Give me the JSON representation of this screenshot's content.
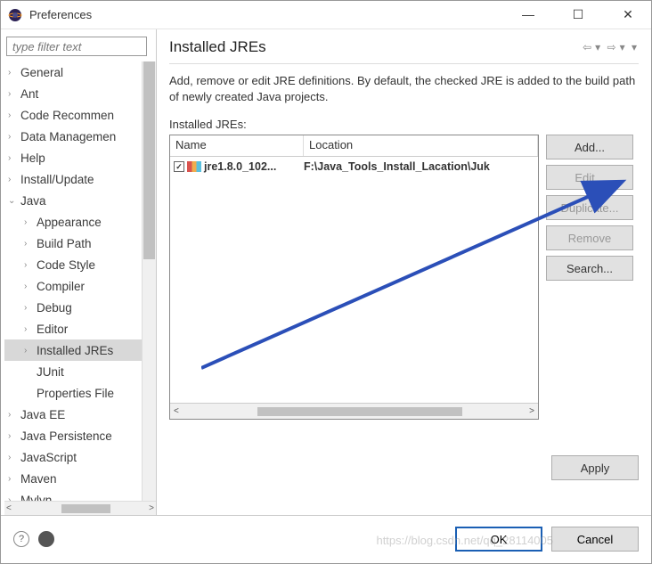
{
  "window": {
    "title": "Preferences"
  },
  "sidebar": {
    "filter_placeholder": "type filter text",
    "items": [
      {
        "label": "General",
        "twisty": "›"
      },
      {
        "label": "Ant",
        "twisty": "›"
      },
      {
        "label": "Code Recommen",
        "twisty": "›"
      },
      {
        "label": "Data Managemen",
        "twisty": "›"
      },
      {
        "label": "Help",
        "twisty": "›"
      },
      {
        "label": "Install/Update",
        "twisty": "›"
      },
      {
        "label": "Java",
        "twisty": "⌄",
        "expanded": true,
        "children": [
          {
            "label": "Appearance",
            "twisty": "›"
          },
          {
            "label": "Build Path",
            "twisty": "›"
          },
          {
            "label": "Code Style",
            "twisty": "›"
          },
          {
            "label": "Compiler",
            "twisty": "›"
          },
          {
            "label": "Debug",
            "twisty": "›"
          },
          {
            "label": "Editor",
            "twisty": "›"
          },
          {
            "label": "Installed JREs",
            "twisty": "›",
            "selected": true
          },
          {
            "label": "JUnit",
            "twisty": ""
          },
          {
            "label": "Properties File",
            "twisty": ""
          }
        ]
      },
      {
        "label": "Java EE",
        "twisty": "›"
      },
      {
        "label": "Java Persistence",
        "twisty": "›"
      },
      {
        "label": "JavaScript",
        "twisty": "›"
      },
      {
        "label": "Maven",
        "twisty": "›"
      },
      {
        "label": "Mylyn",
        "twisty": "›"
      }
    ]
  },
  "content": {
    "heading": "Installed JREs",
    "description": "Add, remove or edit JRE definitions. By default, the checked JRE is added to the build path of newly created Java projects.",
    "table_label": "Installed JREs:",
    "columns": {
      "name": "Name",
      "location": "Location"
    },
    "rows": [
      {
        "checked": true,
        "name": "jre1.8.0_102...",
        "location": "F:\\Java_Tools_Install_Lacation\\Juk"
      }
    ],
    "buttons": {
      "add": "Add...",
      "edit": "Edit...",
      "duplicate": "Duplicate...",
      "remove": "Remove",
      "search": "Search..."
    },
    "apply": "Apply"
  },
  "footer": {
    "ok": "OK",
    "cancel": "Cancel"
  },
  "watermark": "https://blog.csdn.net/qq_28114005"
}
